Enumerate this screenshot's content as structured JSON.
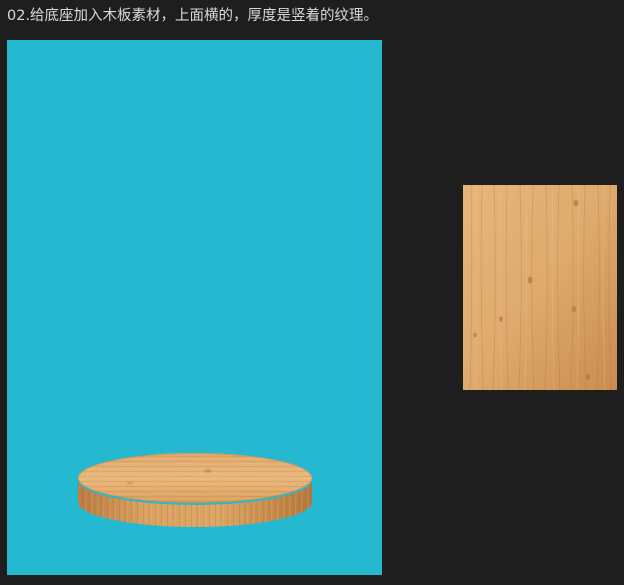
{
  "caption": {
    "text": "02.给底座加入木板素材，上面横的，厚度是竖着的纹理。"
  },
  "colors": {
    "background": "#1e1e1e",
    "canvas": "#25b9d1",
    "wood_light": "#e9b77a",
    "wood_mid": "#d49a59",
    "wood_dark": "#b8773e"
  },
  "elements": {
    "canvas": "blue-canvas",
    "base": "wooden-disc-base",
    "texture": "wood-texture-swatch"
  }
}
